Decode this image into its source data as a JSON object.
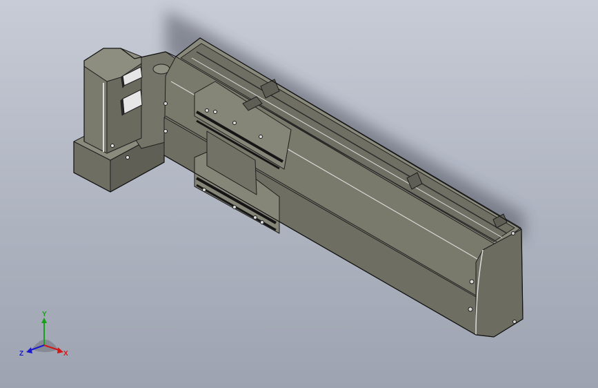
{
  "viewport": {
    "background_top": "#c8ccd6",
    "background_bottom": "#9ea3b1"
  },
  "model": {
    "body_color": "#77776a",
    "edge_color": "#1e1e1e"
  },
  "triad": {
    "x_label": "X",
    "y_label": "Y",
    "z_label": "Z",
    "x_color": "#d01818",
    "y_color": "#18a018",
    "z_color": "#1818d0"
  }
}
